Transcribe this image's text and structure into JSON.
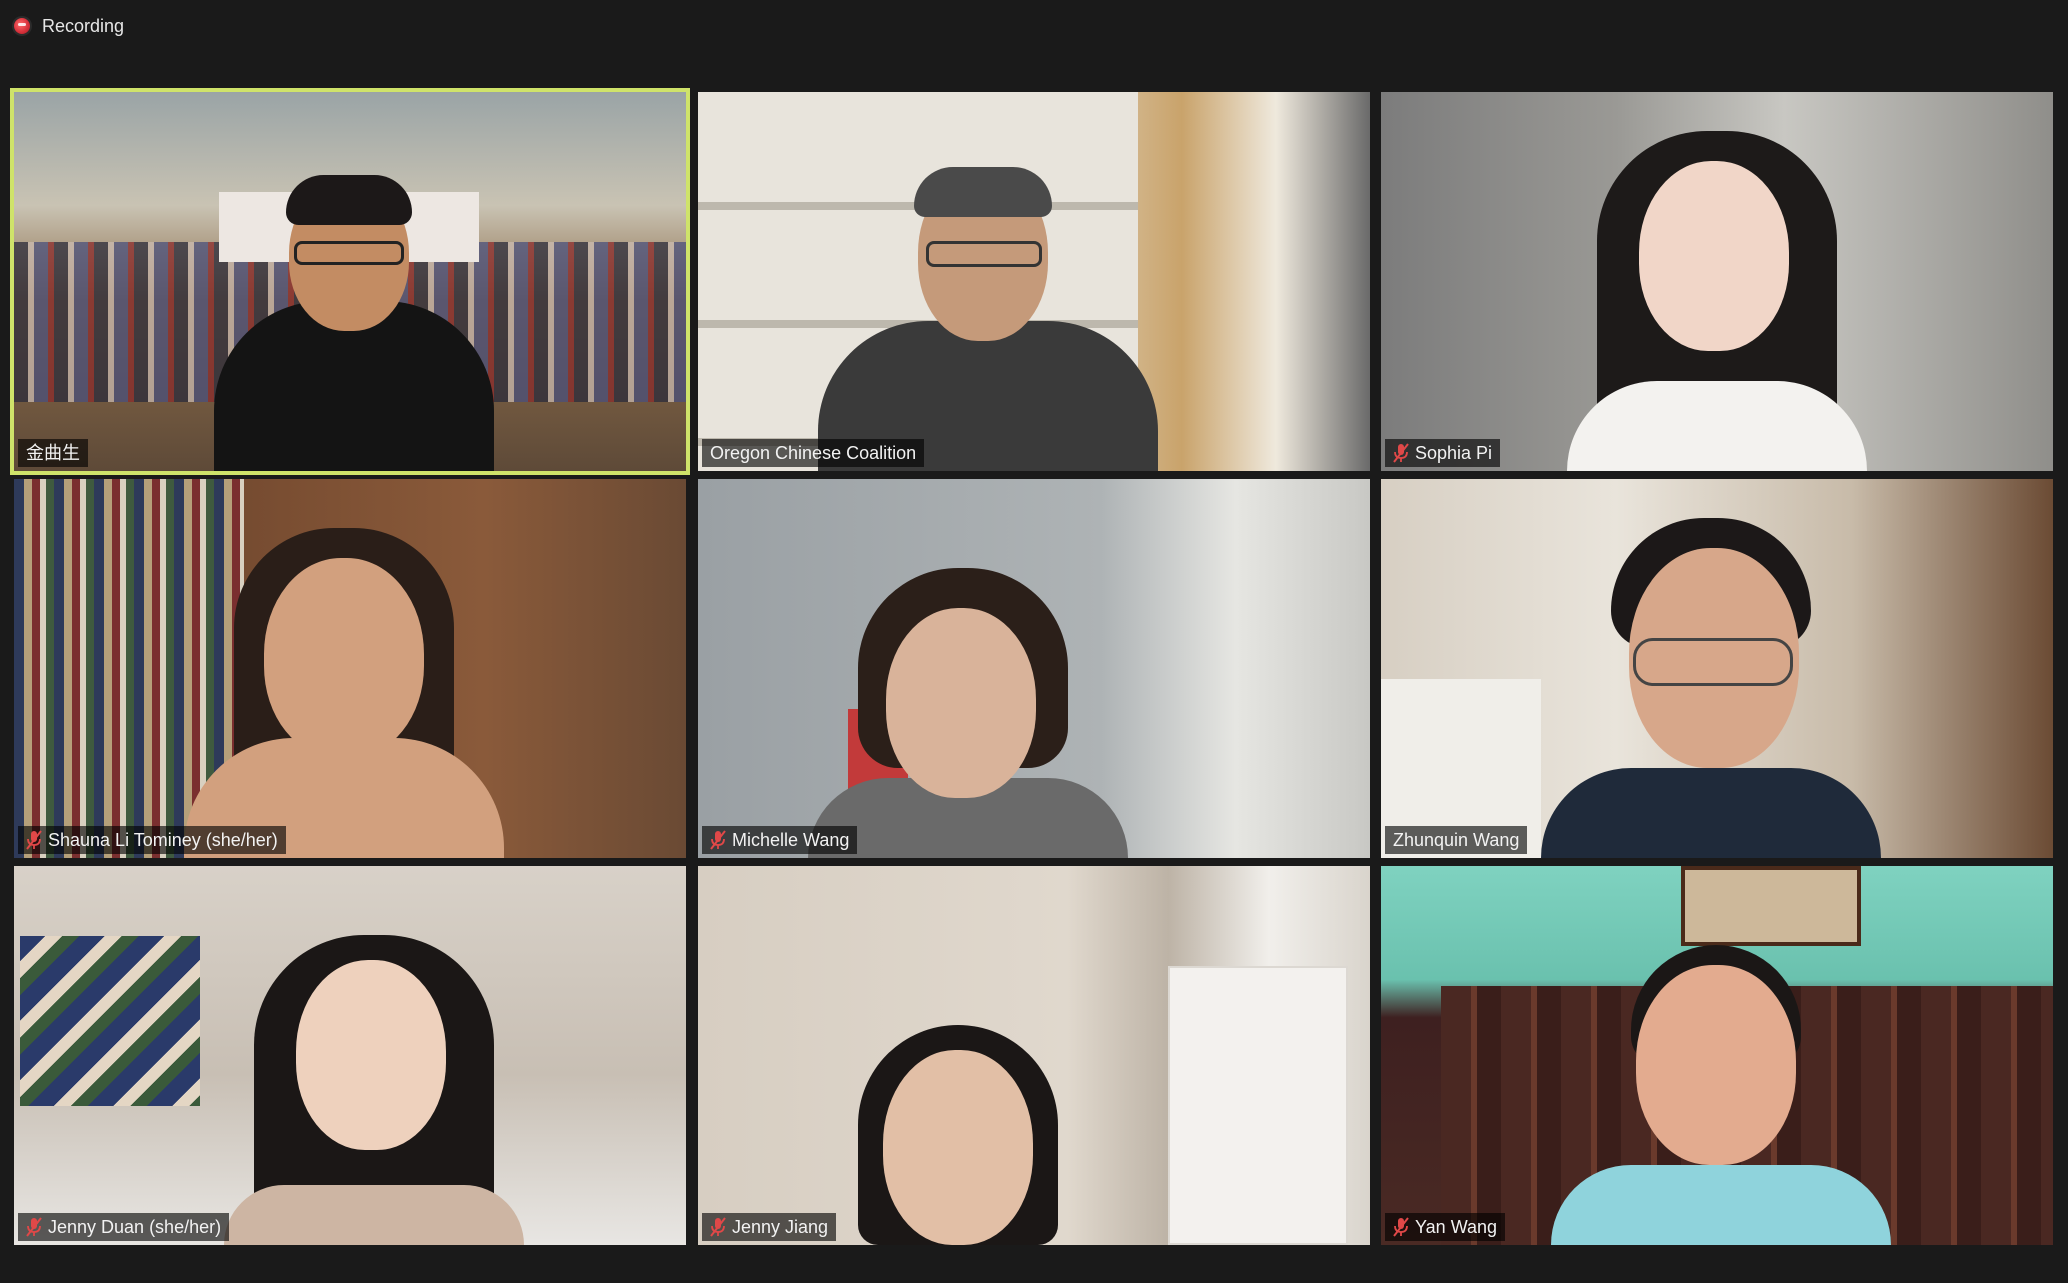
{
  "recording": {
    "label": "Recording",
    "status_color": "#d8323c"
  },
  "meeting": {
    "active_speaker_color": "#cfe36a",
    "participants": [
      {
        "name": "金曲生",
        "muted": false,
        "active_speaker": true
      },
      {
        "name": "Oregon Chinese Coalition",
        "muted": false,
        "active_speaker": false
      },
      {
        "name": "Sophia Pi",
        "muted": true,
        "active_speaker": false
      },
      {
        "name": "Shauna Li Tominey (she/her)",
        "muted": true,
        "active_speaker": false
      },
      {
        "name": "Michelle Wang",
        "muted": true,
        "active_speaker": false
      },
      {
        "name": "Zhunquin Wang",
        "muted": false,
        "active_speaker": false
      },
      {
        "name": "Jenny Duan (she/her)",
        "muted": true,
        "active_speaker": false
      },
      {
        "name": "Jenny Jiang",
        "muted": true,
        "active_speaker": false
      },
      {
        "name": "Yan Wang",
        "muted": true,
        "active_speaker": false
      }
    ]
  },
  "icons": {
    "muted_mic": "mic-muted-icon",
    "recording": "recording-icon"
  }
}
